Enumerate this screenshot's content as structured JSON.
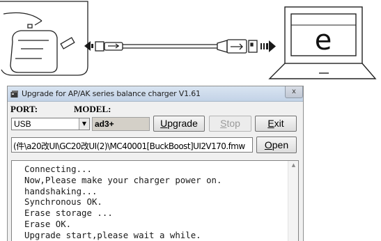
{
  "illustration": {
    "laptop_screen_letter": "e"
  },
  "window": {
    "title": "Upgrade for AP/AK series balance charger V1.61",
    "close_label": "x"
  },
  "port": {
    "label": "PORT:",
    "selected": "USB"
  },
  "model": {
    "label": "MODEL:",
    "value": "ad3+"
  },
  "buttons": {
    "upgrade": {
      "first": "U",
      "rest": "pgrade"
    },
    "stop": {
      "first": "S",
      "rest": "top"
    },
    "exit": {
      "first": "E",
      "rest": "xit"
    },
    "open": {
      "first": "O",
      "rest": "pen"
    }
  },
  "firmware_path": "(件\\a20改UI\\GC20改UI(2)\\MC40001[BuckBoost]UI2V170.fmw",
  "log": [
    "Connecting...",
    "Now,Please make your charger power on.",
    "handshaking...",
    "Synchronous OK.",
    "Erase storage ...",
    "Erase OK.",
    "Upgrade start,please wait a while."
  ],
  "colors": {
    "titlebar": "#c9d8ea",
    "window_bg": "#f0f0f0",
    "disabled_text": "#9a9a9a"
  }
}
